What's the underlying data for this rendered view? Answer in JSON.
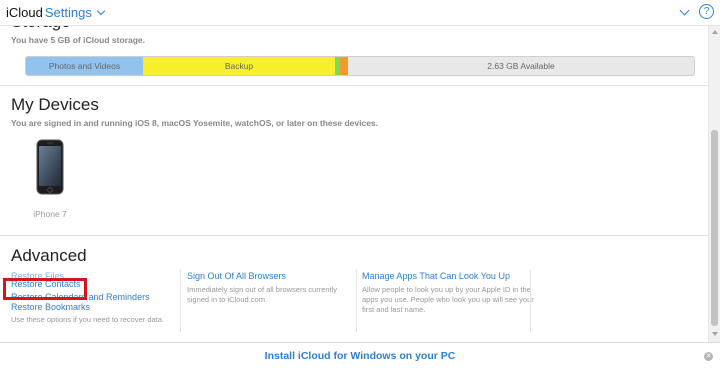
{
  "header": {
    "brand": "iCloud",
    "service": "Settings"
  },
  "storage": {
    "heading": "Storage",
    "subtitle": "You have 5 GB of iCloud storage.",
    "segments": {
      "photos": "Photos and Videos",
      "backup": "Backup",
      "available": "2.63 GB Available"
    },
    "colors": {
      "photos": "#92c2ee",
      "backup": "#f7ef2a",
      "other_green": "#7ed957",
      "other_orange": "#f39a2e",
      "available": "#e8e8e8"
    }
  },
  "devices": {
    "heading": "My Devices",
    "subtitle": "You are signed in and running iOS 8, macOS Yosemite, watchOS, or later on these devices.",
    "items": [
      {
        "label": "iPhone 7"
      }
    ]
  },
  "advanced": {
    "heading": "Advanced",
    "restore": {
      "files": "Restore Files",
      "contacts": "Restore Contacts",
      "calendars": "Restore Calendars and Reminders",
      "bookmarks": "Restore Bookmarks",
      "note": "Use these options if you need to recover data."
    },
    "sign_out": {
      "label": "Sign Out Of All Browsers",
      "desc": "Immediately sign out of all browsers currently signed in to iCloud.com."
    },
    "manage_apps": {
      "label": "Manage Apps That Can Look You Up",
      "desc": "Allow people to look you up by your Apple ID in the apps you use. People who look you up will see your first and last name."
    }
  },
  "footer": {
    "install_label": "Install iCloud for Windows on your PC"
  },
  "colors": {
    "accent": "#2d7fd3",
    "highlight": "#d8141b"
  }
}
